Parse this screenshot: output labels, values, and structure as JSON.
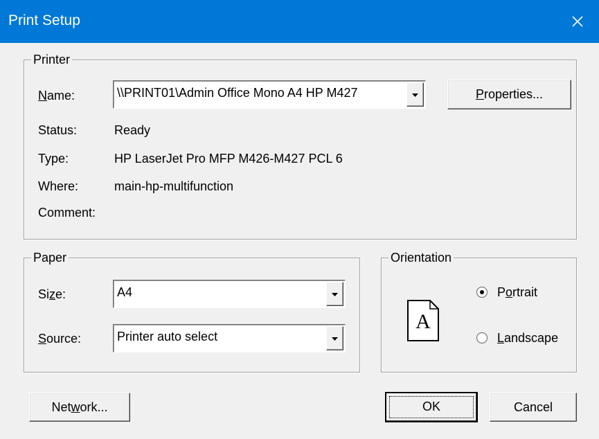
{
  "window": {
    "title": "Print Setup"
  },
  "printer": {
    "group_label": "Printer",
    "name_label": {
      "pre": "",
      "mnemonic": "N",
      "post": "ame:"
    },
    "name_value": "\\\\PRINT01\\Admin Office Mono A4 HP M427",
    "properties_button": {
      "pre": "",
      "mnemonic": "P",
      "post": "roperties..."
    },
    "status_label": "Status:",
    "status_value": "Ready",
    "type_label": "Type:",
    "type_value": "HP LaserJet Pro MFP M426-M427 PCL 6",
    "where_label": "Where:",
    "where_value": "main-hp-multifunction",
    "comment_label": "Comment:",
    "comment_value": ""
  },
  "paper": {
    "group_label": "Paper",
    "size_label": {
      "pre": "Si",
      "mnemonic": "z",
      "post": "e:"
    },
    "size_value": "A4",
    "source_label": {
      "pre": "",
      "mnemonic": "S",
      "post": "ource:"
    },
    "source_value": "Printer auto select"
  },
  "orientation": {
    "group_label": "Orientation",
    "preview_letter": "A",
    "portrait": {
      "pre": "P",
      "mnemonic": "o",
      "post": "rtrait",
      "selected": true
    },
    "landscape": {
      "pre": "",
      "mnemonic": "L",
      "post": "andscape",
      "selected": false
    }
  },
  "buttons": {
    "network": {
      "pre": "Net",
      "mnemonic": "w",
      "post": "ork..."
    },
    "ok": "OK",
    "cancel": "Cancel"
  },
  "colors": {
    "titlebar": "#0078d7",
    "dialog_bg": "#f0f0f0"
  },
  "icons": {
    "close": "close-icon",
    "dropdown": "dropdown-arrow-icon",
    "page": "portrait-page-icon"
  }
}
